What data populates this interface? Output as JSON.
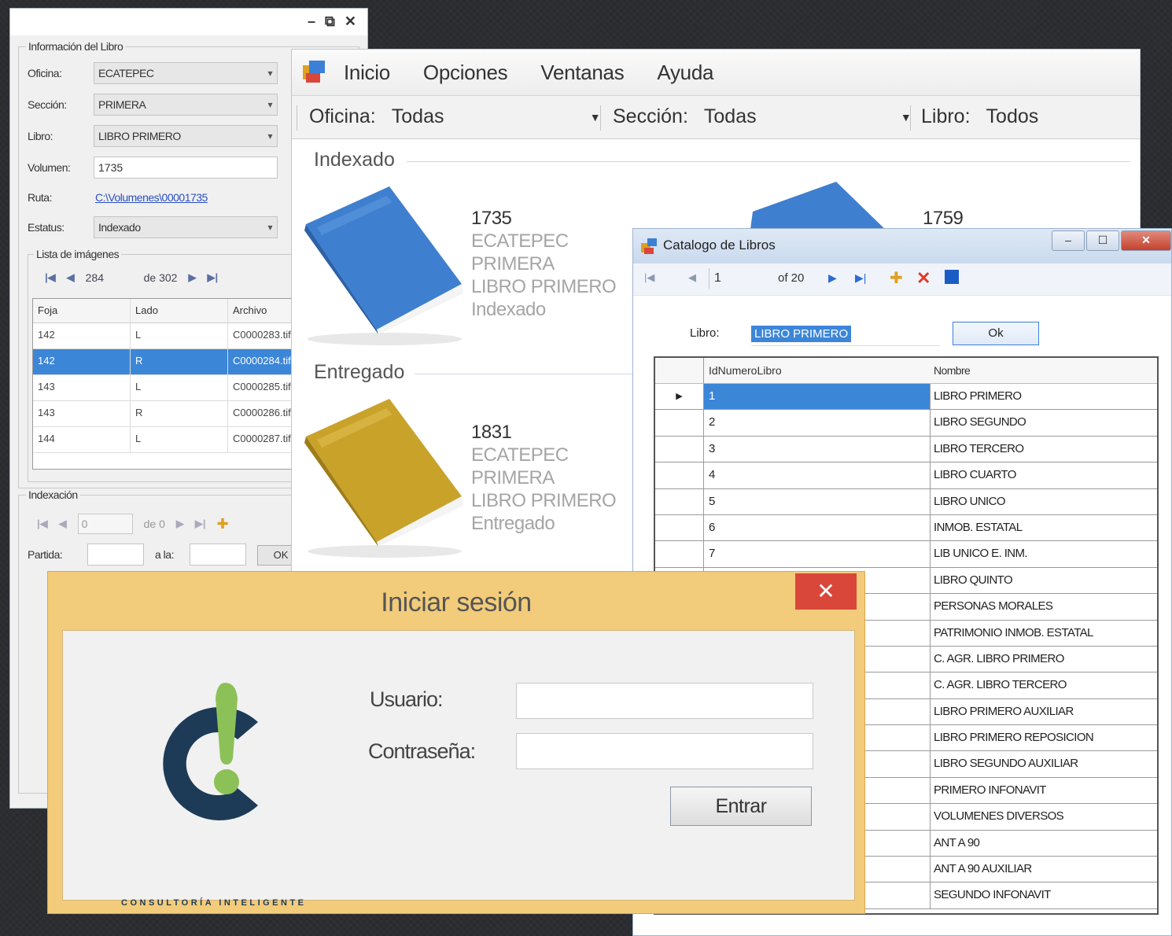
{
  "info_window": {
    "group_title": "Información del Libro",
    "labels": {
      "oficina": "Oficina:",
      "seccion": "Sección:",
      "libro": "Libro:",
      "volumen": "Volumen:",
      "ruta": "Ruta:",
      "estatus": "Estatus:"
    },
    "oficina_value": "ECATEPEC",
    "seccion_value": "PRIMERA",
    "libro_value": "LIBRO PRIMERO",
    "volumen_value": "1735",
    "ruta_value": "C:\\Volumenes\\00001735",
    "estatus_value": "Indexado",
    "images_title": "Lista de imágenes",
    "nav_current": "284",
    "nav_total": "de 302",
    "grid_headers": [
      "Foja",
      "Lado",
      "Archivo"
    ],
    "rows": [
      {
        "foja": "142",
        "lado": "L",
        "archivo": "C0000283.tif"
      },
      {
        "foja": "142",
        "lado": "R",
        "archivo": "C0000284.tif"
      },
      {
        "foja": "143",
        "lado": "L",
        "archivo": "C0000285.tif"
      },
      {
        "foja": "143",
        "lado": "R",
        "archivo": "C0000286.tif"
      },
      {
        "foja": "144",
        "lado": "L",
        "archivo": "C0000287.tif"
      }
    ],
    "index_title": "Indexación",
    "index_nav_current": "0",
    "index_nav_total": "de 0",
    "partida_label": "Partida:",
    "a_la_label": "a la:",
    "ok_label": "OK"
  },
  "main_window": {
    "menu": [
      "Inicio",
      "Opciones",
      "Ventanas",
      "Ayuda"
    ],
    "filters": {
      "oficina_label": "Oficina:",
      "oficina_value": "Todas",
      "seccion_label": "Sección:",
      "seccion_value": "Todas",
      "libro_label": "Libro:",
      "libro_value": "Todos"
    },
    "section_indexado": "Indexado",
    "section_entregado": "Entregado",
    "book_indexado": {
      "volumen": "1735",
      "oficina": "ECATEPEC",
      "seccion": "PRIMERA",
      "libro": "LIBRO PRIMERO",
      "estatus": "Indexado",
      "color": "#3f7fcf"
    },
    "book_indexado_2": {
      "volumen": "1759"
    },
    "book_entregado": {
      "volumen": "1831",
      "oficina": "ECATEPEC",
      "seccion": "PRIMERA",
      "libro": "LIBRO PRIMERO",
      "estatus": "Entregado",
      "color": "#c9a22a"
    }
  },
  "catalog_window": {
    "title": "Catalogo de Libros",
    "nav_current": "1",
    "nav_total": "of 20",
    "libro_label": "Libro:",
    "libro_value": "LIBRO PRIMERO",
    "ok_label": "Ok",
    "headers": [
      "IdNumeroLibro",
      "Nombre"
    ],
    "rows": [
      {
        "id": "1",
        "nombre": "LIBRO PRIMERO"
      },
      {
        "id": "2",
        "nombre": "LIBRO SEGUNDO"
      },
      {
        "id": "3",
        "nombre": "LIBRO TERCERO"
      },
      {
        "id": "4",
        "nombre": "LIBRO CUARTO"
      },
      {
        "id": "5",
        "nombre": "LIBRO UNICO"
      },
      {
        "id": "6",
        "nombre": "INMOB. ESTATAL"
      },
      {
        "id": "7",
        "nombre": "LIB UNICO E. INM."
      },
      {
        "id": "",
        "nombre": "LIBRO QUINTO"
      },
      {
        "id": "",
        "nombre": "PERSONAS MORALES"
      },
      {
        "id": "",
        "nombre": "PATRIMONIO INMOB. ESTATAL"
      },
      {
        "id": "",
        "nombre": "C. AGR. LIBRO PRIMERO"
      },
      {
        "id": "",
        "nombre": "C. AGR. LIBRO TERCERO"
      },
      {
        "id": "",
        "nombre": "LIBRO PRIMERO AUXILIAR"
      },
      {
        "id": "",
        "nombre": "LIBRO PRIMERO REPOSICION"
      },
      {
        "id": "",
        "nombre": "LIBRO SEGUNDO AUXILIAR"
      },
      {
        "id": "",
        "nombre": "PRIMERO INFONAVIT"
      },
      {
        "id": "",
        "nombre": "VOLUMENES DIVERSOS"
      },
      {
        "id": "",
        "nombre": "ANT A 90"
      },
      {
        "id": "",
        "nombre": "ANT A 90 AUXILIAR"
      },
      {
        "id": "",
        "nombre": "SEGUNDO INFONAVIT"
      }
    ]
  },
  "login_window": {
    "title": "Iniciar sesión",
    "close_glyph": "✕",
    "usuario_label": "Usuario:",
    "contrasena_label": "Contraseña:",
    "entrar_label": "Entrar",
    "logo_text": "CONSULTORÍA INTELIGENTE",
    "logo_colors": {
      "dark": "#1d3b57",
      "accent": "#8cc157"
    }
  }
}
